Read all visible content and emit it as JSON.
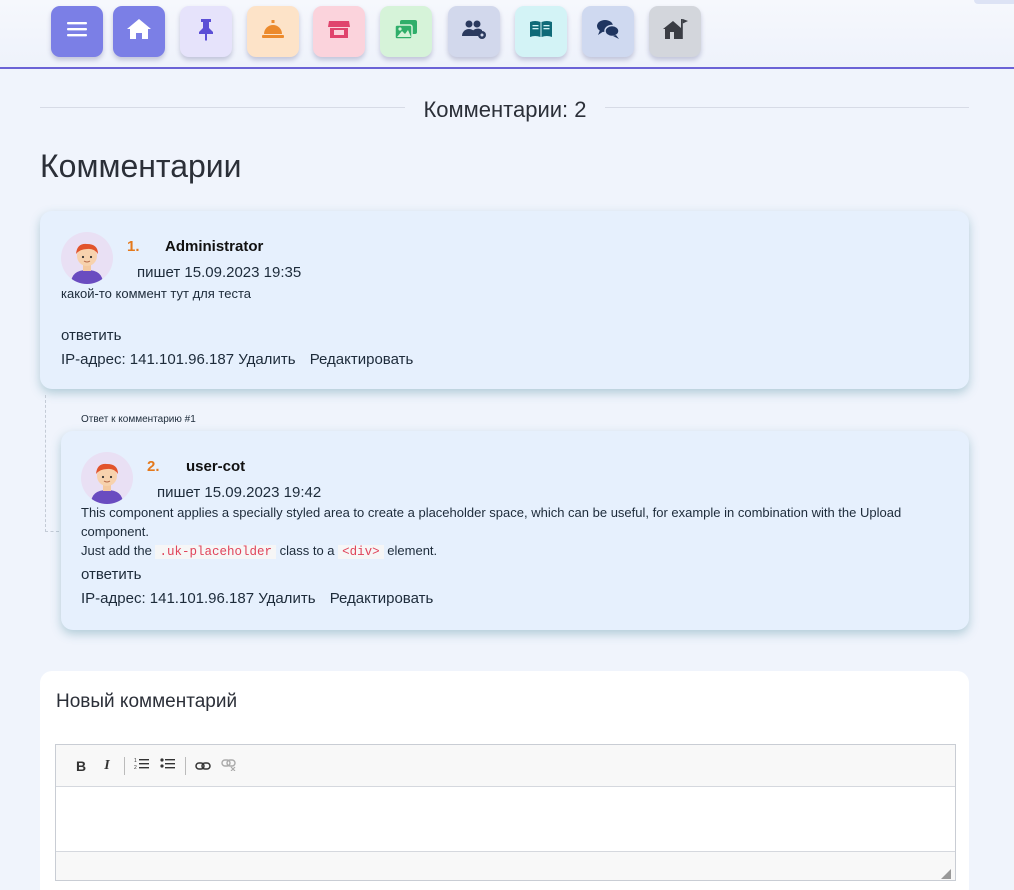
{
  "nav": {
    "buttons": [
      {
        "icon": "menu-icon",
        "color": "#7b7fe6"
      },
      {
        "icon": "home-icon",
        "color": "#7b7fe6"
      },
      {
        "icon": "pin-icon",
        "color": "#e6e3fb"
      },
      {
        "icon": "reception-bell-icon",
        "color": "#fde3c8"
      },
      {
        "icon": "store-icon",
        "color": "#fbd3dc"
      },
      {
        "icon": "photos-icon",
        "color": "#d6f3d9"
      },
      {
        "icon": "users-settings-icon",
        "color": "#d2d8ec"
      },
      {
        "icon": "book-open-icon",
        "color": "#d3f3f6"
      },
      {
        "icon": "chat-icon",
        "color": "#cfd9f0"
      },
      {
        "icon": "house-flag-icon",
        "color": "#d3d6dc"
      }
    ]
  },
  "count_label": "Комментарии: 2",
  "page_title": "Комментарии",
  "comments": [
    {
      "number": "1.",
      "author": "Administrator",
      "meta": "пишет 15.09.2023 19:35",
      "text": "какой-то коммент тут для теста",
      "reply": "ответить",
      "ip": "IP-адрес: 141.101.96.187",
      "delete": "Удалить",
      "edit": "Редактировать"
    },
    {
      "number": "2.",
      "author": "user-cot",
      "meta": "пишет 15.09.2023 19:42",
      "text_line1": "This component applies a specially styled area to create a placeholder space, which can be useful, for example in combination with the Upload component.",
      "text_pre": "Just add the",
      "code1": ".uk-placeholder",
      "text_mid": "class to a",
      "code2": "<div>",
      "text_post": "element.",
      "reply": "ответить",
      "ip": "IP-адрес: 141.101.96.187",
      "delete": "Удалить",
      "edit": "Редактировать"
    }
  ],
  "reply_note": "Ответ к комментарию #1",
  "new_comment": {
    "title": "Новый комментарий",
    "toolbar": [
      "B",
      "I"
    ]
  },
  "colors": {
    "accent": "#6b63d6",
    "number": "#e4791c",
    "card": "#e6f0fd",
    "code": "#e0445a"
  }
}
